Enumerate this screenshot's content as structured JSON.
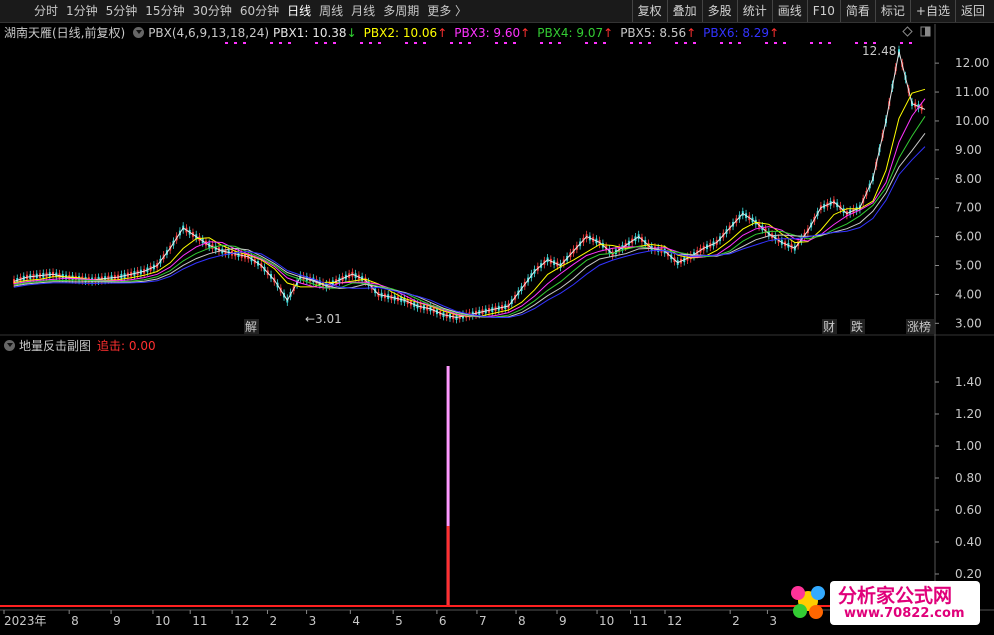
{
  "toolbar": {
    "periods": [
      "分时",
      "1分钟",
      "5分钟",
      "15分钟",
      "30分钟",
      "60分钟",
      "日线",
      "周线",
      "月线",
      "多周期",
      "更多 〉"
    ],
    "active_period": "日线",
    "tools": [
      "复权",
      "叠加",
      "多股",
      "统计",
      "画线",
      "F10",
      "简看",
      "标记",
      "+自选",
      "返回"
    ]
  },
  "main_header": {
    "stock": "湖南天雁(日线,前复权)",
    "indicator": "PBX(4,6,9,13,18,24)",
    "pbx": [
      {
        "label": "PBX1: 10.38",
        "arrow": "↓",
        "color": "#e6e6e6",
        "arrow_color": "#2fd02f"
      },
      {
        "label": "PBX2: 10.06",
        "arrow": "↑",
        "color": "#ffff00",
        "arrow_color": "#ff3030"
      },
      {
        "label": "PBX3: 9.60",
        "arrow": "↑",
        "color": "#ff33ff",
        "arrow_color": "#ff3030"
      },
      {
        "label": "PBX4: 9.07",
        "arrow": "↑",
        "color": "#33cc33",
        "arrow_color": "#ff3030"
      },
      {
        "label": "PBX5: 8.56",
        "arrow": "↑",
        "color": "#c8c8c8",
        "arrow_color": "#ff3030"
      },
      {
        "label": "PBX6: 8.29",
        "arrow": "↑",
        "color": "#3333ff",
        "arrow_color": "#ff3030"
      }
    ]
  },
  "sub_header": {
    "title": "地量反击副图",
    "value_label": "追击: 0.00"
  },
  "annotations": {
    "max_label": "12.48",
    "min_label": "←3.01",
    "events": [
      {
        "text": "解",
        "color": "#33cccc"
      },
      {
        "text": "财",
        "color": "#66a3ff"
      },
      {
        "text": "跌",
        "color": "#33dd33"
      },
      {
        "text": "涨榜",
        "color": "#ff6666"
      }
    ]
  },
  "watermark": {
    "site": "分析家公式网",
    "url": "www.70822.com"
  },
  "chart_data": [
    {
      "type": "candlestick-line",
      "title": "湖南天雁(日线,前复权)",
      "ylim": [
        2.7,
        12.8
      ],
      "yticks": [
        3.0,
        4.0,
        5.0,
        6.0,
        7.0,
        8.0,
        9.0,
        10.0,
        11.0,
        12.0
      ],
      "ytick_labels": [
        "3.00",
        "4.00",
        "5.00",
        "6.00",
        "7.00",
        "8.00",
        "9.00",
        "10.00",
        "11.00",
        "12.00"
      ],
      "xlabels": [
        "2023年",
        "8",
        "9",
        "10",
        "11",
        "12",
        "2",
        "3",
        "4",
        "5",
        "6",
        "7",
        "8",
        "9",
        "10",
        "11",
        "12",
        "2",
        "3"
      ],
      "xlabel_pos": [
        0,
        0.07,
        0.115,
        0.16,
        0.2,
        0.245,
        0.283,
        0.325,
        0.372,
        0.418,
        0.465,
        0.508,
        0.55,
        0.594,
        0.637,
        0.673,
        0.71,
        0.78,
        0.82
      ],
      "close_path": [
        4.45,
        4.6,
        4.65,
        4.7,
        4.6,
        4.55,
        4.5,
        4.55,
        4.6,
        4.7,
        4.8,
        5.0,
        5.6,
        6.3,
        6.0,
        5.7,
        5.5,
        5.4,
        5.3,
        5.0,
        4.5,
        3.8,
        4.6,
        4.5,
        4.3,
        4.5,
        4.7,
        4.5,
        4.0,
        3.9,
        3.8,
        3.6,
        3.5,
        3.3,
        3.2,
        3.3,
        3.4,
        3.5,
        3.6,
        4.2,
        4.8,
        5.2,
        5.0,
        5.5,
        6.0,
        5.8,
        5.4,
        5.7,
        6.0,
        5.6,
        5.5,
        5.1,
        5.3,
        5.6,
        5.8,
        6.3,
        6.8,
        6.5,
        6.1,
        5.8,
        5.6,
        6.2,
        7.0,
        7.2,
        6.8,
        7.0,
        8.0,
        10.0,
        12.4,
        10.6,
        10.4
      ],
      "series": [
        {
          "name": "PBX1",
          "color": "#e6e6e6",
          "last": 10.38
        },
        {
          "name": "PBX2",
          "color": "#ffff00",
          "last": 10.06
        },
        {
          "name": "PBX3",
          "color": "#ff33ff",
          "last": 9.6
        },
        {
          "name": "PBX4",
          "color": "#33cc33",
          "last": 9.07
        },
        {
          "name": "PBX5",
          "color": "#c8c8c8",
          "last": 8.56
        },
        {
          "name": "PBX6",
          "color": "#3333ff",
          "last": 8.29
        }
      ]
    },
    {
      "type": "bar",
      "title": "地量反击副图",
      "ylim": [
        0,
        1.6
      ],
      "yticks": [
        0.2,
        0.4,
        0.6,
        0.8,
        1.0,
        1.2,
        1.4
      ],
      "ytick_labels": [
        "0.20",
        "0.40",
        "0.60",
        "0.80",
        "1.00",
        "1.20",
        "1.40"
      ],
      "bars": [
        {
          "x_frac": 0.477,
          "value": 1.5,
          "color": "#ff99ff"
        },
        {
          "x_frac": 0.477,
          "value": 0.5,
          "color": "#ff3030"
        }
      ]
    }
  ]
}
